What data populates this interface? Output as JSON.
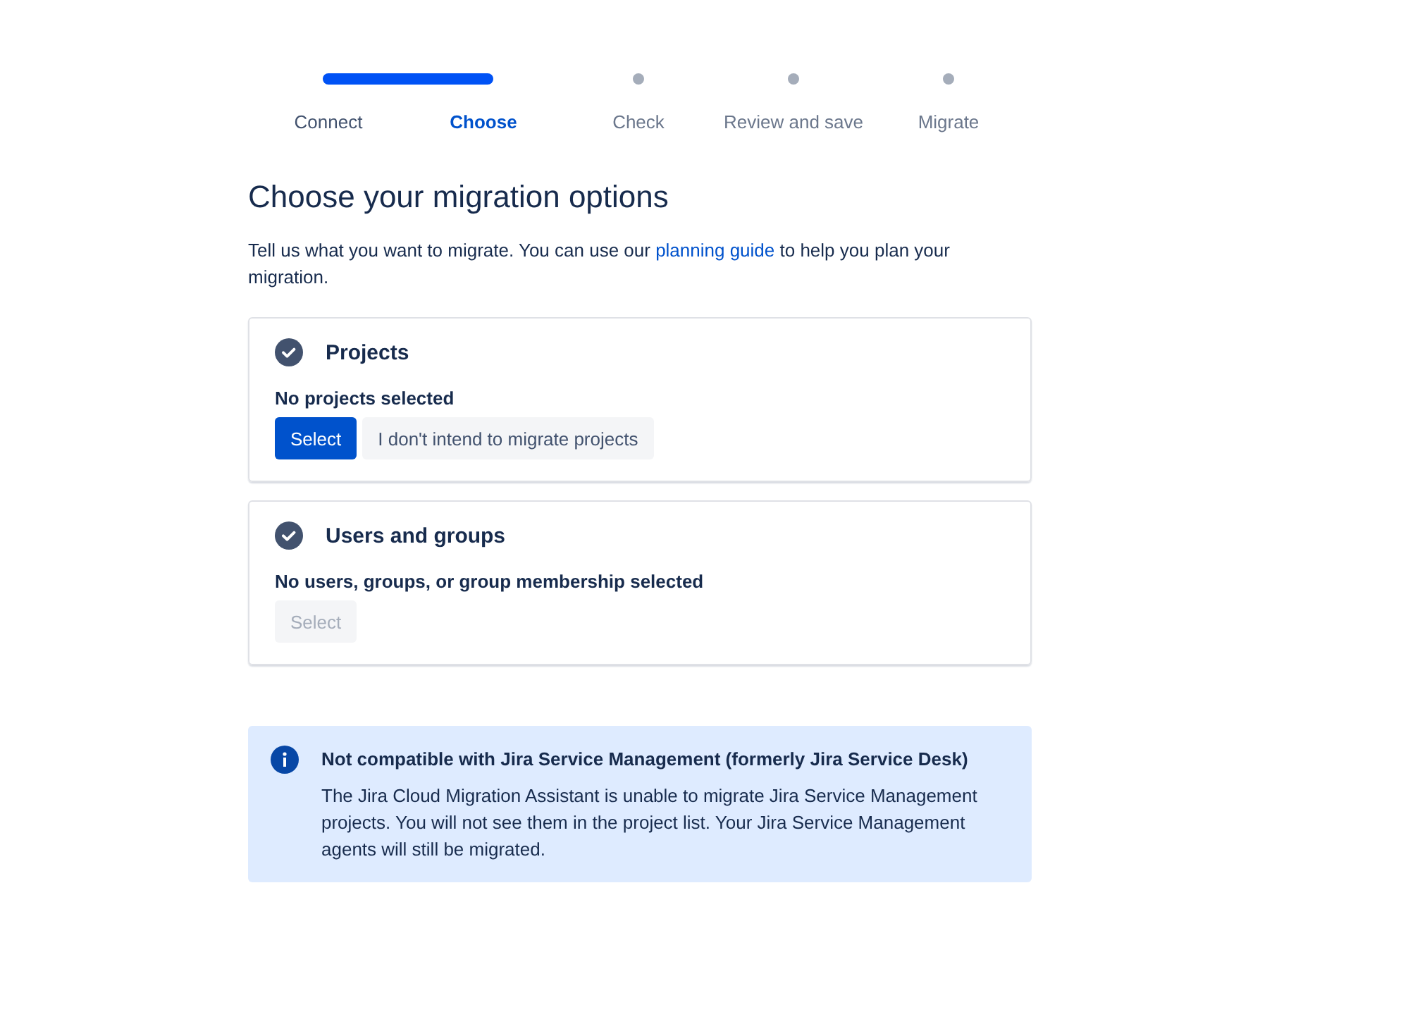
{
  "steps": [
    {
      "label": "Connect",
      "complete": true,
      "selected": false
    },
    {
      "label": "Choose",
      "complete": false,
      "selected": true
    },
    {
      "label": "Check",
      "complete": false,
      "selected": false
    },
    {
      "label": "Review and save",
      "complete": false,
      "selected": false
    },
    {
      "label": "Migrate",
      "complete": false,
      "selected": false
    }
  ],
  "heading": "Choose your migration options",
  "intro": {
    "before": "Tell us what you want to migrate. You can use our ",
    "link": "planning guide",
    "after": " to help you plan your migration."
  },
  "sections": [
    {
      "title": "Projects",
      "status": "No projects selected",
      "buttons": [
        {
          "label": "Select",
          "kind": "primary",
          "disabled": false
        },
        {
          "label": "I don't intend to migrate projects",
          "kind": "subtle",
          "disabled": false
        }
      ]
    },
    {
      "title": "Users and groups",
      "status": "No users, groups, or group membership selected",
      "buttons": [
        {
          "label": "Select",
          "kind": "primary",
          "disabled": true
        }
      ]
    }
  ],
  "notice": {
    "title": "Not compatible with Jira Service Management (formerly Jira Service Desk)",
    "body": "The Jira Cloud Migration Assistant is unable to migrate Jira Service Management projects. You will not see them in the project list. Your Jira Service Management agents will still be migrated."
  }
}
